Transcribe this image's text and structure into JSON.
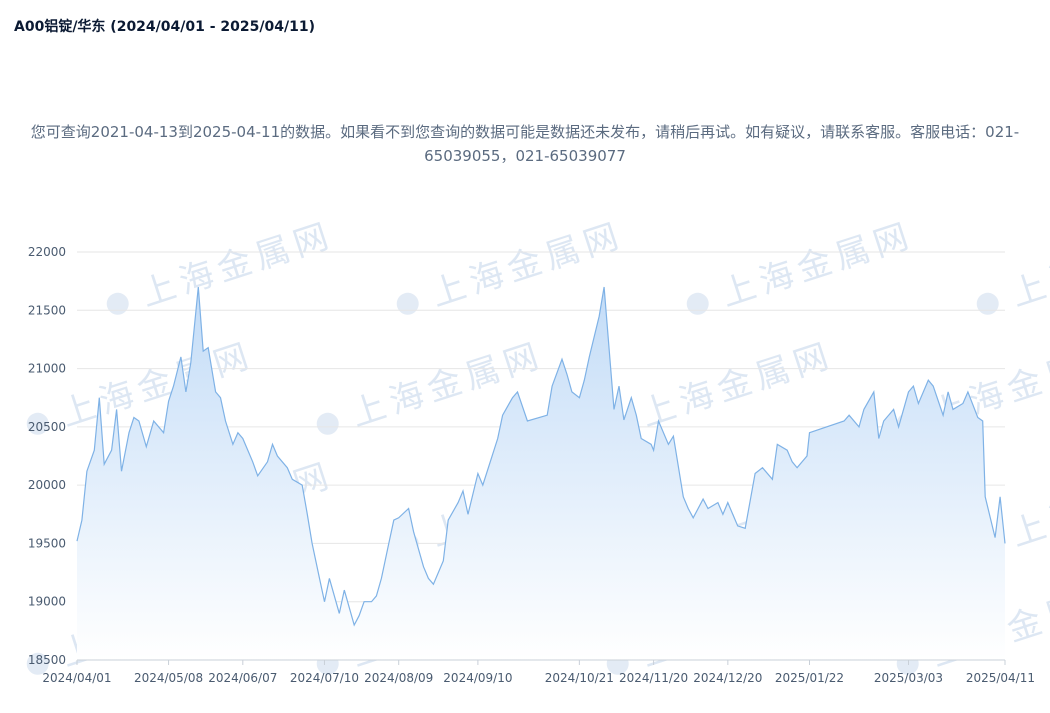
{
  "title": "A00铝锭/华东  (2024/04/01 - 2025/04/11)",
  "notice": "您可查询2021-04-13到2025-04-11的数据。如果看不到您查询的数据可能是数据还未发布，请稍后再试。如有疑议，请联系客服。客服电话：021-65039055，021-65039077",
  "watermark": "上海金属网",
  "colors": {
    "line": "#7fb2e6",
    "fill_top": "#c3dcf7",
    "fill_bottom": "#ffffff",
    "grid": "#e6e6e6"
  },
  "chart_data": {
    "type": "area",
    "title": "A00铝锭/华东  (2024/04/01 - 2025/04/11)",
    "xlabel": "",
    "ylabel": "",
    "ylim": [
      18500,
      22000
    ],
    "yticks": [
      18500,
      19000,
      19500,
      20000,
      20500,
      21000,
      21500,
      22000
    ],
    "xlim": [
      "2024/04/01",
      "2025/04/11"
    ],
    "xticks": [
      "2024/04/01",
      "2024/05/08",
      "2024/06/07",
      "2024/07/10",
      "2024/08/09",
      "2024/09/10",
      "2024/10/21",
      "2024/11/20",
      "2024/12/20",
      "2025/01/22",
      "2025/03/03",
      "2025/04/11"
    ],
    "grid": true,
    "series": [
      {
        "x": [
          "2024/04/01",
          "2024/04/03",
          "2024/04/05",
          "2024/04/08",
          "2024/04/10",
          "2024/04/12",
          "2024/04/15",
          "2024/04/17",
          "2024/04/19",
          "2024/04/22",
          "2024/04/24",
          "2024/04/26",
          "2024/04/29",
          "2024/05/02",
          "2024/05/06",
          "2024/05/08",
          "2024/05/10",
          "2024/05/13",
          "2024/05/15",
          "2024/05/17",
          "2024/05/20",
          "2024/05/22",
          "2024/05/24",
          "2024/05/27",
          "2024/05/29",
          "2024/05/31",
          "2024/06/03",
          "2024/06/05",
          "2024/06/07",
          "2024/06/11",
          "2024/06/13",
          "2024/06/17",
          "2024/06/19",
          "2024/06/21",
          "2024/06/25",
          "2024/06/27",
          "2024/07/01",
          "2024/07/03",
          "2024/07/05",
          "2024/07/08",
          "2024/07/10",
          "2024/07/12",
          "2024/07/16",
          "2024/07/18",
          "2024/07/22",
          "2024/07/24",
          "2024/07/26",
          "2024/07/29",
          "2024/07/31",
          "2024/08/02",
          "2024/08/05",
          "2024/08/07",
          "2024/08/09",
          "2024/08/13",
          "2024/08/15",
          "2024/08/19",
          "2024/08/21",
          "2024/08/23",
          "2024/08/27",
          "2024/08/29",
          "2024/09/02",
          "2024/09/04",
          "2024/09/06",
          "2024/09/10",
          "2024/09/12",
          "2024/09/18",
          "2024/09/20",
          "2024/09/24",
          "2024/09/26",
          "2024/09/30",
          "2024/10/08",
          "2024/10/10",
          "2024/10/14",
          "2024/10/16",
          "2024/10/18",
          "2024/10/21",
          "2024/10/23",
          "2024/10/25",
          "2024/10/29",
          "2024/10/31",
          "2024/11/04",
          "2024/11/06",
          "2024/11/08",
          "2024/11/11",
          "2024/11/13",
          "2024/11/15",
          "2024/11/19",
          "2024/11/20",
          "2024/11/22",
          "2024/11/26",
          "2024/11/28",
          "2024/12/02",
          "2024/12/04",
          "2024/12/06",
          "2024/12/10",
          "2024/12/12",
          "2024/12/16",
          "2024/12/18",
          "2024/12/20",
          "2024/12/24",
          "2024/12/27",
          "2024/12/31",
          "2025/01/03",
          "2025/01/07",
          "2025/01/09",
          "2025/01/13",
          "2025/01/15",
          "2025/01/17",
          "2025/01/21",
          "2025/01/22",
          "2025/02/05",
          "2025/02/07",
          "2025/02/11",
          "2025/02/13",
          "2025/02/17",
          "2025/02/19",
          "2025/02/21",
          "2025/02/25",
          "2025/02/27",
          "2025/03/03",
          "2025/03/05",
          "2025/03/07",
          "2025/03/11",
          "2025/03/13",
          "2025/03/17",
          "2025/03/19",
          "2025/03/21",
          "2025/03/25",
          "2025/03/27",
          "2025/03/31",
          "2025/04/02",
          "2025/04/03",
          "2025/04/07",
          "2025/04/09",
          "2025/04/11"
        ],
        "values": [
          19520,
          19700,
          20120,
          20300,
          20750,
          20180,
          20300,
          20650,
          20120,
          20450,
          20580,
          20550,
          20330,
          20550,
          20450,
          20720,
          20850,
          21100,
          20800,
          21050,
          21700,
          21150,
          21180,
          20800,
          20750,
          20550,
          20350,
          20450,
          20400,
          20200,
          20080,
          20200,
          20350,
          20250,
          20150,
          20050,
          20000,
          19760,
          19500,
          19200,
          19000,
          19200,
          18900,
          19100,
          18800,
          18880,
          19000,
          19000,
          19050,
          19200,
          19500,
          19700,
          19720,
          19800,
          19600,
          19300,
          19200,
          19150,
          19350,
          19700,
          19850,
          19950,
          19750,
          20100,
          20000,
          20400,
          20600,
          20750,
          20800,
          20550,
          20600,
          20850,
          21080,
          20950,
          20800,
          20750,
          20900,
          21100,
          21450,
          21700,
          20650,
          20850,
          20560,
          20750,
          20600,
          20400,
          20350,
          20300,
          20550,
          20350,
          20420,
          19900,
          19800,
          19720,
          19880,
          19800,
          19850,
          19750,
          19850,
          19650,
          19630,
          20100,
          20150,
          20050,
          20350,
          20300,
          20200,
          20150,
          20250,
          20450,
          20550,
          20600,
          20500,
          20650,
          20800,
          20400,
          20550,
          20650,
          20500,
          20800,
          20850,
          20700,
          20900,
          20850,
          20600,
          20800,
          20650,
          20700,
          20800,
          20580,
          20550,
          19900,
          19550,
          19900,
          19500
        ]
      }
    ]
  }
}
